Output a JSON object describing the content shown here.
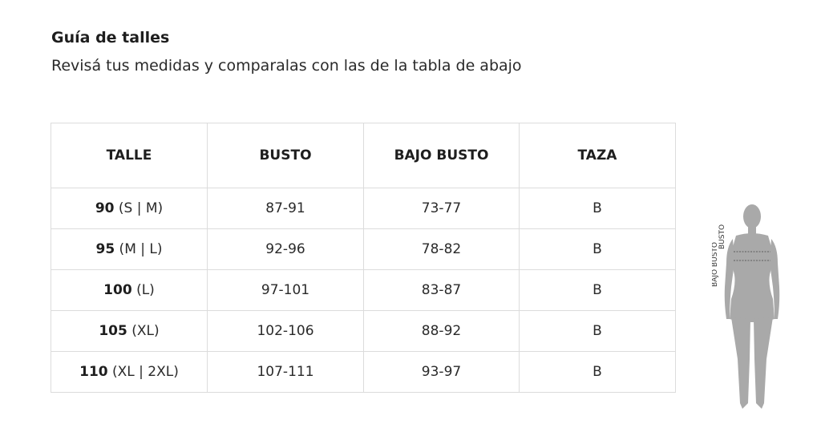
{
  "header": {
    "title": "Guía de talles",
    "subtitle": "Revisá tus medidas y comparalas con las de la tabla de abajo"
  },
  "table": {
    "columns": [
      "TALLE",
      "BUSTO",
      "BAJO BUSTO",
      "TAZA"
    ],
    "rows": [
      {
        "talle_num": "90",
        "talle_sizes": " (S | M)",
        "busto": "87-91",
        "bajo_busto": "73-77",
        "taza": "B"
      },
      {
        "talle_num": "95",
        "talle_sizes": " (M | L)",
        "busto": "92-96",
        "bajo_busto": "78-82",
        "taza": "B"
      },
      {
        "talle_num": "100",
        "talle_sizes": " (L)",
        "busto": "97-101",
        "bajo_busto": "83-87",
        "taza": "B"
      },
      {
        "talle_num": "105",
        "talle_sizes": " (XL)",
        "busto": "102-106",
        "bajo_busto": "88-92",
        "taza": "B"
      },
      {
        "talle_num": "110",
        "talle_sizes": " (XL | 2XL)",
        "busto": "107-111",
        "bajo_busto": "93-97",
        "taza": "B"
      }
    ]
  },
  "figure": {
    "label_busto": "BUSTO",
    "label_bajo_busto": "BAJO BUSTO",
    "body_color": "#a9a9a9"
  }
}
